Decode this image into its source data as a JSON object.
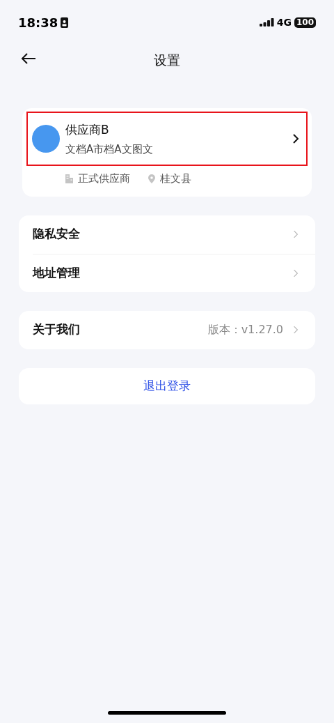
{
  "status_bar": {
    "time": "18:38",
    "network": "4G",
    "battery": "100"
  },
  "nav": {
    "title": "设置"
  },
  "profile": {
    "name": "供应商B",
    "subtitle": "文档A市档A文图文",
    "highlighted": true,
    "tags": [
      {
        "kind": "building",
        "label": "正式供应商"
      },
      {
        "kind": "location",
        "label": "桂文县"
      }
    ]
  },
  "menu_groups": [
    {
      "items": [
        {
          "label": "隐私安全"
        },
        {
          "label": "地址管理"
        }
      ]
    },
    {
      "items": [
        {
          "label": "关于我们",
          "value": "版本：v1.27.0"
        }
      ]
    }
  ],
  "logout": {
    "label": "退出登录"
  }
}
